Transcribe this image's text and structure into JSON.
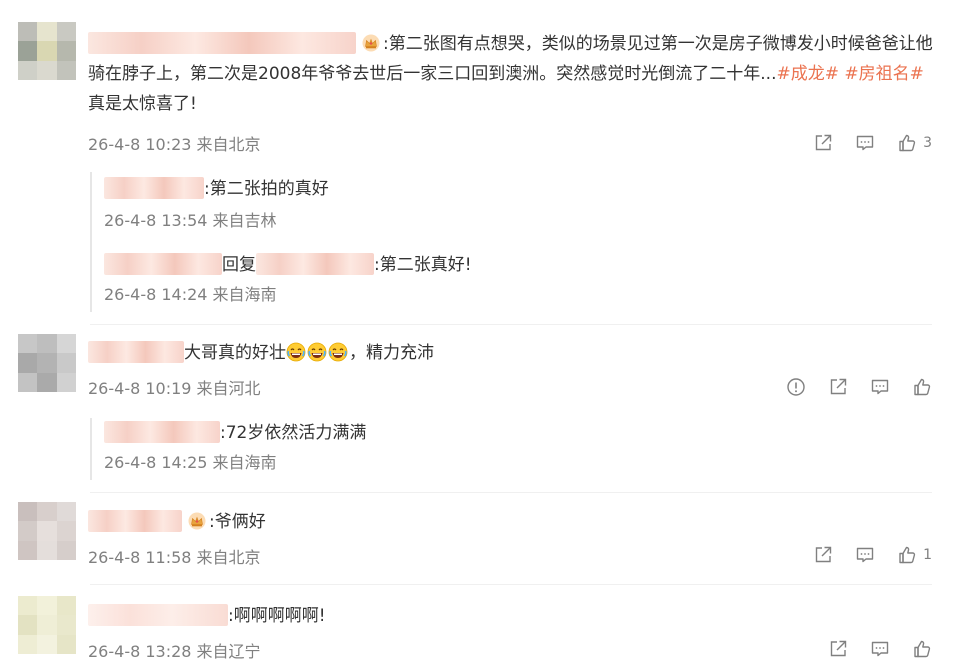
{
  "comments": [
    {
      "text": ":第二张图有点想哭，类似的场景见过第一次是房子微博发小时候爸爸让他骑在脖子上，第二次是2008年爷爷去世后一家三口回到澳洲。突然感觉时光倒流了二十年...",
      "tag1": "#成龙#",
      "tag2": "#房祖名#",
      "tail": " 真是太惊喜了!",
      "meta": "26-4-8 10:23 来自北京",
      "like_count": "3",
      "replies": [
        {
          "text": ":第二张拍的真好",
          "meta": "26-4-8 13:54 来自吉林"
        },
        {
          "reply_word": "回复",
          "text": ":第二张真好!",
          "meta": "26-4-8 14:24 来自海南"
        }
      ]
    },
    {
      "text_before": "大哥真的好壮",
      "text_after": "，精力充沛",
      "meta": "26-4-8 10:19 来自河北",
      "replies": [
        {
          "text": ":72岁依然活力满满",
          "meta": "26-4-8 14:25 来自海南"
        }
      ]
    },
    {
      "text": ":爷俩好",
      "meta": "26-4-8 11:58 来自北京",
      "like_count": "1"
    },
    {
      "text": ":啊啊啊啊啊!",
      "meta": "26-4-8 13:28 来自辽宁"
    }
  ],
  "icons": {
    "share": "share-icon",
    "comment": "comment-icon",
    "like": "like-icon",
    "report": "report-icon",
    "crown": "crown-badge-icon",
    "emoji": "laugh-cry-emoji"
  },
  "colors": {
    "tag": "#eb7350",
    "meta": "#808080",
    "text": "#333333"
  }
}
